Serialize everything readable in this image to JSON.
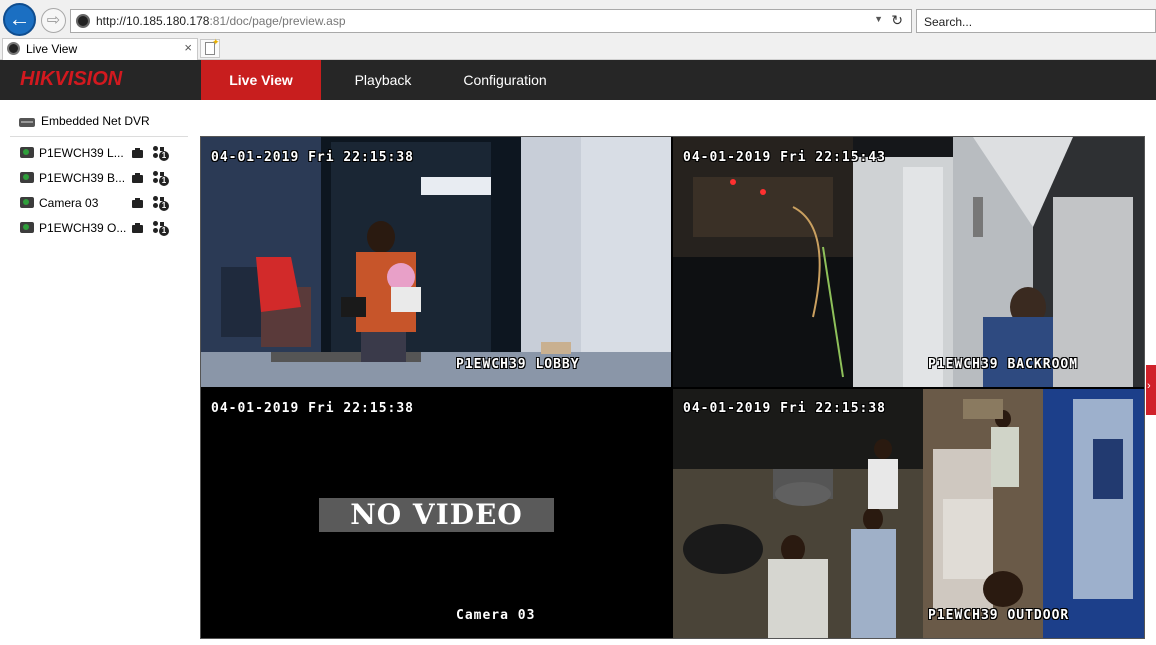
{
  "browser": {
    "url_host": "http://10.185.180.178",
    "url_rest": ":81/doc/page/preview.asp",
    "search_placeholder": "Search...",
    "tab_title": "Live View",
    "tab_close": "×",
    "back_glyph": "←",
    "forward_glyph": "⇨",
    "refresh_glyph": "↻",
    "dropdown_glyph": "▼"
  },
  "header": {
    "logo": "HIKVISION",
    "nav": [
      {
        "label": "Live View",
        "active": true
      },
      {
        "label": "Playback",
        "active": false
      },
      {
        "label": "Configuration",
        "active": false
      }
    ]
  },
  "sidebar": {
    "device": "Embedded Net DVR",
    "cameras": [
      {
        "label": "P1EWCH39 L..."
      },
      {
        "label": "P1EWCH39 B..."
      },
      {
        "label": "Camera 03"
      },
      {
        "label": "P1EWCH39 O..."
      }
    ],
    "ptz_badge": "1"
  },
  "tiles": [
    {
      "timestamp": "04-01-2019 Fri 22:15:38",
      "name": "P1EWCH39 LOBBY"
    },
    {
      "timestamp": "04-01-2019 Fri 22:15:43",
      "name": "P1EWCH39 BACKROOM"
    },
    {
      "timestamp": "04-01-2019 Fri 22:15:38",
      "name": "Camera 03",
      "overlay": "NO VIDEO"
    },
    {
      "timestamp": "04-01-2019 Fri 22:15:38",
      "name": "P1EWCH39 OUTDOOR"
    }
  ],
  "side_handle_glyph": "›",
  "colors": {
    "accent": "#c81e1e",
    "header_bg": "#262626",
    "logo": "#d2191f",
    "selected_border": "#d4a82a"
  }
}
